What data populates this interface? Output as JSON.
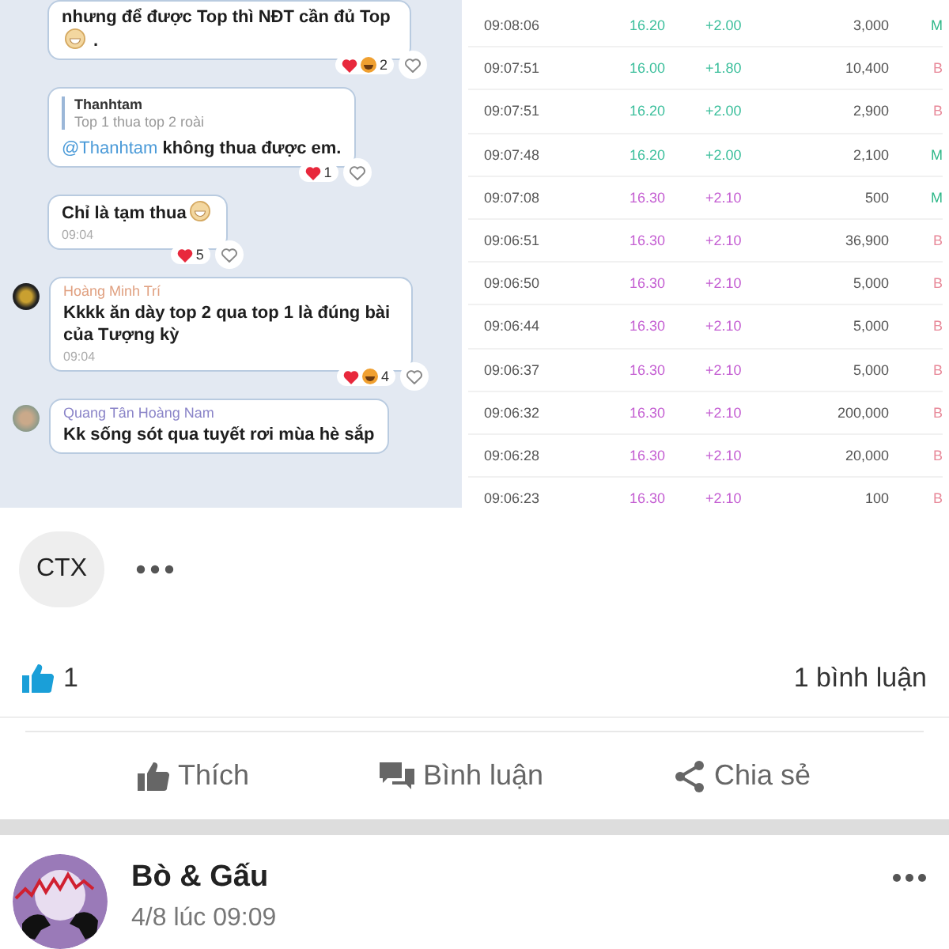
{
  "post_image": {
    "chat": [
      {
        "text": "nhưng để được Top thì NĐT cần đủ Top",
        "emoji": true,
        "suffix": " .",
        "reactions": [
          {
            "kind": "heart"
          },
          {
            "kind": "haha"
          }
        ],
        "count": "2"
      },
      {
        "quote": {
          "author": "Thanhtam",
          "text": "Top 1 thua top 2 roài"
        },
        "mention": "@Thanhtam",
        "text": " không thua được em.",
        "reactions": [
          {
            "kind": "heart"
          }
        ],
        "count": "1"
      },
      {
        "text": "Chỉ là tạm thua",
        "emoji": true,
        "time": "09:04",
        "reactions": [
          {
            "kind": "heart"
          }
        ],
        "count": "5"
      },
      {
        "sender": {
          "name": "Hoàng Minh Trí",
          "color": "#e0a080"
        },
        "avatar": {
          "kind": "dark"
        },
        "text": "Kkkk ăn dày top 2 qua top 1 là đúng bài của Tượng kỳ",
        "time": "09:04",
        "reactions": [
          {
            "kind": "heart"
          },
          {
            "kind": "haha"
          }
        ],
        "count": "4"
      },
      {
        "sender": {
          "name": "Quang Tân Hoàng Nam",
          "color": "#8a84c8"
        },
        "avatar": {
          "kind": "light"
        },
        "text": "Kk sống sót qua tuyết rơi mùa hè sắp"
      }
    ],
    "trades": [
      {
        "time": "09:08:06",
        "price": "16.20",
        "change": "+2.00",
        "volume": "3,000",
        "color": "#3cbf9c",
        "side": {
          "label": "M",
          "color": "#2fb889"
        }
      },
      {
        "time": "09:07:51",
        "price": "16.00",
        "change": "+1.80",
        "volume": "10,400",
        "color": "#3cbf9c",
        "side": {
          "label": "B",
          "color": "#e88a9a"
        }
      },
      {
        "time": "09:07:51",
        "price": "16.20",
        "change": "+2.00",
        "volume": "2,900",
        "color": "#3cbf9c",
        "side": {
          "label": "B",
          "color": "#e88a9a"
        }
      },
      {
        "time": "09:07:48",
        "price": "16.20",
        "change": "+2.00",
        "volume": "2,100",
        "color": "#3cbf9c",
        "side": {
          "label": "M",
          "color": "#2fb889"
        }
      },
      {
        "time": "09:07:08",
        "price": "16.30",
        "change": "+2.10",
        "volume": "500",
        "color": "#c45ed2",
        "side": {
          "label": "M",
          "color": "#2fb889"
        }
      },
      {
        "time": "09:06:51",
        "price": "16.30",
        "change": "+2.10",
        "volume": "36,900",
        "color": "#c45ed2",
        "side": {
          "label": "B",
          "color": "#e88a9a"
        }
      },
      {
        "time": "09:06:50",
        "price": "16.30",
        "change": "+2.10",
        "volume": "5,000",
        "color": "#c45ed2",
        "side": {
          "label": "B",
          "color": "#e88a9a"
        }
      },
      {
        "time": "09:06:44",
        "price": "16.30",
        "change": "+2.10",
        "volume": "5,000",
        "color": "#c45ed2",
        "side": {
          "label": "B",
          "color": "#e88a9a"
        }
      },
      {
        "time": "09:06:37",
        "price": "16.30",
        "change": "+2.10",
        "volume": "5,000",
        "color": "#c45ed2",
        "side": {
          "label": "B",
          "color": "#e88a9a"
        }
      },
      {
        "time": "09:06:32",
        "price": "16.30",
        "change": "+2.10",
        "volume": "200,000",
        "color": "#c45ed2",
        "side": {
          "label": "B",
          "color": "#e88a9a"
        }
      },
      {
        "time": "09:06:28",
        "price": "16.30",
        "change": "+2.10",
        "volume": "20,000",
        "color": "#c45ed2",
        "side": {
          "label": "B",
          "color": "#e88a9a"
        }
      },
      {
        "time": "09:06:23",
        "price": "16.30",
        "change": "+2.10",
        "volume": "100",
        "color": "#c45ed2",
        "side": {
          "label": "B",
          "color": "#e88a9a"
        }
      }
    ]
  },
  "tag": "CTX",
  "likes": "1",
  "comments": "1 bình luận",
  "actions": [
    {
      "kind": "like",
      "label": "Thích"
    },
    {
      "kind": "comment",
      "label": "Bình luận"
    },
    {
      "kind": "share",
      "label": "Chia sẻ"
    }
  ],
  "next_post": {
    "name": "Bò & Gấu",
    "time": "4/8 lúc 09:09"
  }
}
